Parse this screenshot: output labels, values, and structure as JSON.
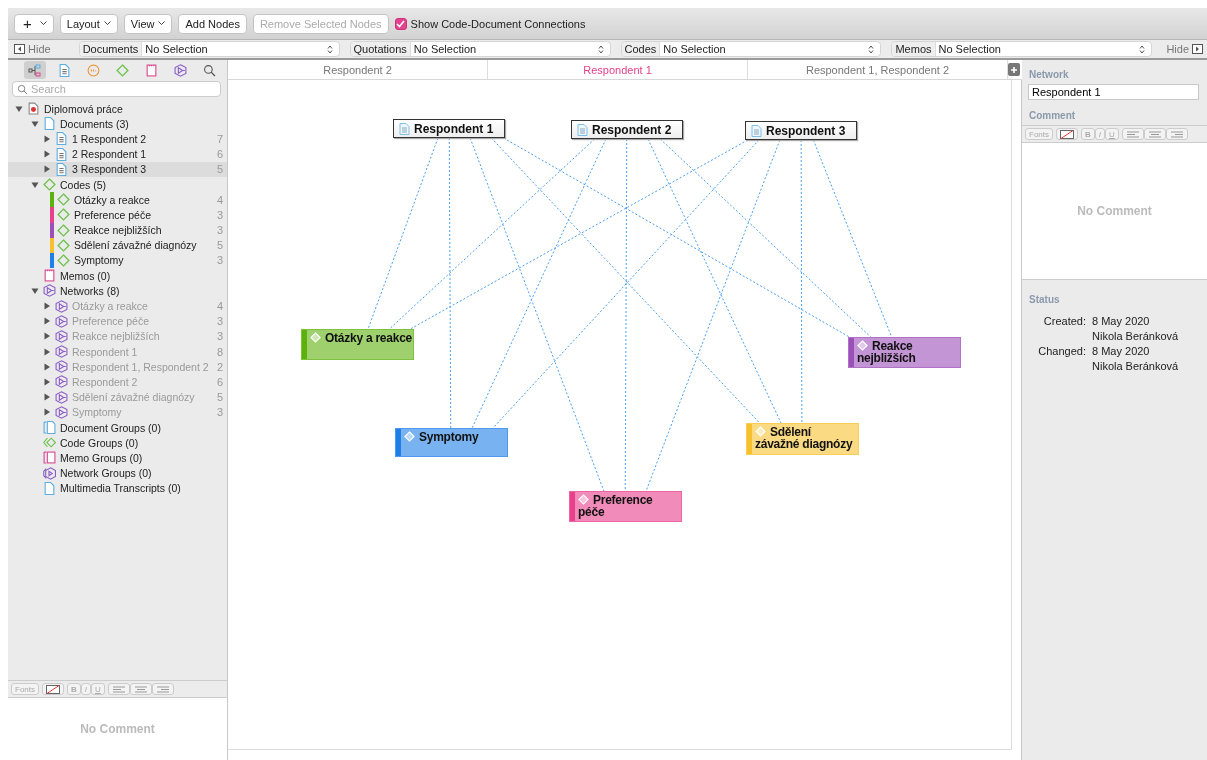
{
  "toolbar": {
    "add_menu": "+",
    "buttons": [
      {
        "label": "Layout",
        "kind": "menu",
        "disabled": false
      },
      {
        "label": "View",
        "kind": "menu",
        "disabled": false
      },
      {
        "label": "Add Nodes",
        "kind": "plain",
        "disabled": false
      },
      {
        "label": "Remove Selected Nodes",
        "kind": "plain",
        "disabled": true
      }
    ],
    "show_connections": {
      "label": "Show Code-Document Connections",
      "checked": true
    }
  },
  "filter_bar": {
    "hide_left": "Hide",
    "hide_right": "Hide",
    "filters": [
      {
        "label": "Documents",
        "value": "No Selection"
      },
      {
        "label": "Quotations",
        "value": "No Selection"
      },
      {
        "label": "Codes",
        "value": "No Selection"
      },
      {
        "label": "Memos",
        "value": "No Selection"
      }
    ]
  },
  "navigator_tabs": [
    {
      "kind": "project",
      "selected": true
    },
    {
      "kind": "document",
      "selected": false
    },
    {
      "kind": "quotation",
      "selected": false
    },
    {
      "kind": "code",
      "selected": false
    },
    {
      "kind": "memo",
      "selected": false
    },
    {
      "kind": "network",
      "selected": false
    },
    {
      "kind": "search",
      "selected": false
    }
  ],
  "search": {
    "placeholder": "Search"
  },
  "tree": {
    "label": "Diplomová práce",
    "kind": "project",
    "expanded": true,
    "children": [
      {
        "label": "Documents (3)",
        "kind": "documents",
        "expanded": true,
        "children": [
          {
            "label": "1 Respondent 2",
            "kind": "document",
            "count": "7",
            "expanded": false,
            "selected": false
          },
          {
            "label": "2 Respondent 1",
            "kind": "document",
            "count": "6",
            "expanded": false,
            "selected": false
          },
          {
            "label": "3 Respondent 3",
            "kind": "document",
            "count": "5",
            "expanded": false,
            "selected": true
          }
        ]
      },
      {
        "label": "Codes (5)",
        "kind": "codes",
        "expanded": true,
        "children": [
          {
            "label": "Otázky a reakce",
            "kind": "code",
            "count": "4",
            "color": "#5db10c"
          },
          {
            "label": "Preference péče",
            "kind": "code",
            "count": "3",
            "color": "#e8408c"
          },
          {
            "label": "Reakce nejbližších",
            "kind": "code",
            "count": "3",
            "color": "#9b4fb8"
          },
          {
            "label": "Sdělení závažné diagnózy",
            "kind": "code",
            "count": "5",
            "color": "#f7c12e"
          },
          {
            "label": "Symptomy",
            "kind": "code",
            "count": "3",
            "color": "#1f7fe8"
          }
        ]
      },
      {
        "label": "Memos (0)",
        "kind": "memos"
      },
      {
        "label": "Networks (8)",
        "kind": "networks",
        "expanded": true,
        "children": [
          {
            "label": "Otázky a reakce",
            "kind": "network",
            "count": "4",
            "expanded": false,
            "dimmed": true
          },
          {
            "label": "Preference péče",
            "kind": "network",
            "count": "3",
            "expanded": false,
            "dimmed": true
          },
          {
            "label": "Reakce nejbližších",
            "kind": "network",
            "count": "3",
            "expanded": false,
            "dimmed": true
          },
          {
            "label": "Respondent 1",
            "kind": "network",
            "count": "8",
            "expanded": false,
            "dimmed": true
          },
          {
            "label": "Respondent 1, Respondent 2",
            "kind": "network",
            "count": "2",
            "expanded": false,
            "dimmed": true
          },
          {
            "label": "Respondent 2",
            "kind": "network",
            "count": "6",
            "expanded": false,
            "dimmed": true
          },
          {
            "label": "Sdělení závažné diagnózy",
            "kind": "network",
            "count": "5",
            "expanded": false,
            "dimmed": true
          },
          {
            "label": "Symptomy",
            "kind": "network",
            "count": "3",
            "expanded": false,
            "dimmed": true
          }
        ]
      },
      {
        "label": "Document Groups (0)",
        "kind": "document-groups"
      },
      {
        "label": "Code Groups (0)",
        "kind": "code-groups"
      },
      {
        "label": "Memo Groups (0)",
        "kind": "memo-groups"
      },
      {
        "label": "Network Groups (0)",
        "kind": "network-groups"
      },
      {
        "label": "Multimedia Transcripts (0)",
        "kind": "transcripts"
      }
    ]
  },
  "left_comment": {
    "format_bar": {
      "fonts": "Fonts",
      "bold": "B",
      "italic": "I",
      "underline": "U"
    },
    "empty_text": "No Comment"
  },
  "network_tabs": [
    {
      "label": "Respondent 2",
      "selected": false
    },
    {
      "label": "Respondent 1",
      "selected": true
    },
    {
      "label": "Respondent 1, Respondent 2",
      "selected": false
    }
  ],
  "network": {
    "documents": [
      {
        "label": "Respondent 1"
      },
      {
        "label": "Respondent 2"
      },
      {
        "label": "Respondent 3"
      }
    ],
    "codes": [
      {
        "label": "Otázky a reakce",
        "color": "#5db10c"
      },
      {
        "label": "Reakce nejbližších",
        "color": "#9b4fb8"
      },
      {
        "label": "Symptomy",
        "color": "#1f7fe8"
      },
      {
        "label": "Sdělení závažné diagnózy",
        "color": "#f7c12e"
      },
      {
        "label": "Preference péče",
        "color": "#e8408c"
      }
    ]
  },
  "inspector": {
    "network_heading": "Network",
    "name_value": "Respondent 1",
    "comment_heading": "Comment",
    "format_bar": {
      "fonts": "Fonts",
      "bold": "B",
      "italic": "I",
      "underline": "U"
    },
    "empty_text": "No Comment",
    "status_heading": "Status",
    "status": [
      {
        "label": "Created:",
        "date": "8 May 2020",
        "author": "Nikola Beránková"
      },
      {
        "label": "Changed:",
        "date": "8 May 2020",
        "author": "Nikola Beránková"
      }
    ]
  }
}
